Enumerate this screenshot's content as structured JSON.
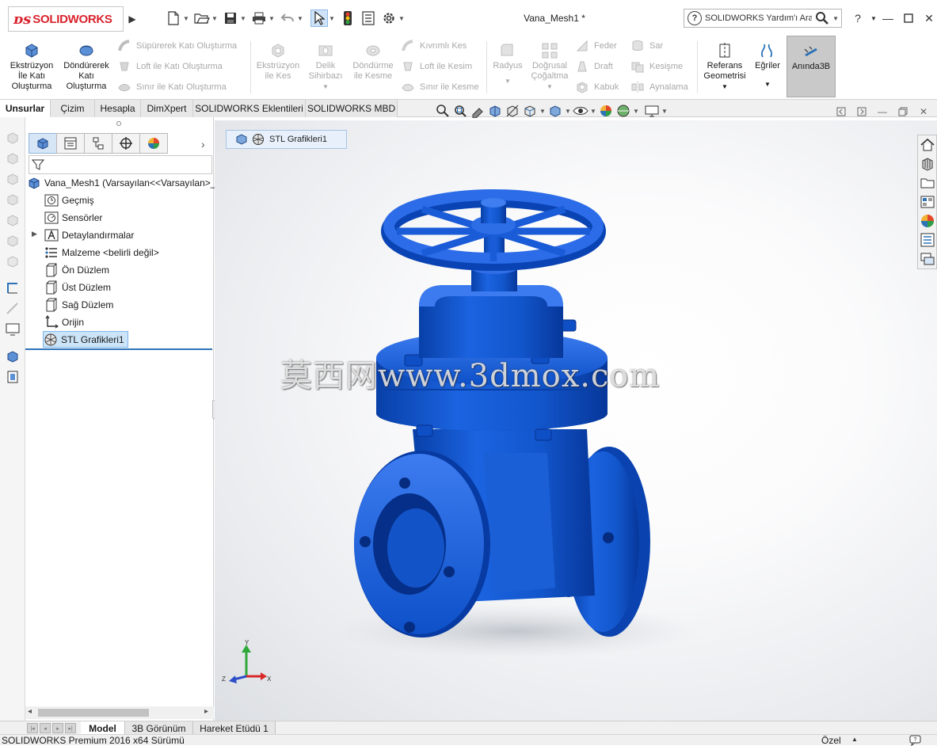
{
  "app": {
    "logo": "SOLIDWORKS",
    "document_title": "Vana_Mesh1 *",
    "help_search_placeholder": "SOLIDWORKS Yardım'ı Ara"
  },
  "ribbon": {
    "extrude_boss": "Ekstrüzyon İle Katı Oluşturma",
    "revolve_boss": "Döndürerek Katı Oluşturma",
    "swept_boss": "Süpürerek Katı Oluşturma",
    "loft_boss": "Loft ile Katı Oluşturma",
    "boundary_boss": "Sınır ile Katı Oluşturma",
    "extruded_cut": "Ekstrüzyon ile Kes",
    "hole_wizard": "Delik Sihirbazı",
    "revolved_cut": "Döndürme ile Kesme",
    "swept_cut": "Kıvrımlı Kes",
    "lofted_cut": "Loft ile Kesim",
    "boundary_cut": "Sınır ile Kesme",
    "fillet": "Radyus",
    "linear_pattern": "Doğrusal Çoğaltma",
    "rib": "Feder",
    "draft": "Draft",
    "shell": "Kabuk",
    "wrap": "Sar",
    "intersect": "Kesişme",
    "mirror": "Aynalama",
    "reference_geometry": "Referans Geometrisi",
    "curves": "Eğriler",
    "instant3d": "Anında3B"
  },
  "tabs": [
    "Unsurlar",
    "Çizim",
    "Hesapla",
    "DimXpert",
    "SOLIDWORKS Eklentileri",
    "SOLIDWORKS MBD"
  ],
  "feature_tree": {
    "root": "Vana_Mesh1  (Varsayılan<<Varsayılan>_",
    "items": [
      "Geçmiş",
      "Sensörler",
      "Detaylandırmalar",
      "Malzeme <belirli değil>",
      "Ön Düzlem",
      "Üst Düzlem",
      "Sağ Düzlem",
      "Orijin",
      "STL Grafikleri1"
    ]
  },
  "graphics": {
    "breadcrumb": "STL Grafikleri1",
    "watermark": "莫西网www.3dmox.com",
    "triad": {
      "x": "X",
      "y": "Y",
      "z": "Z"
    }
  },
  "bottom_tabs": [
    "Model",
    "3B Görünüm",
    "Hareket Etüdü 1"
  ],
  "status": {
    "version": "SOLIDWORKS Premium 2016 x64 Sürümü",
    "units": "Özel"
  },
  "colors": {
    "model_blue": "#0d50c8",
    "accent": "#2d73b8",
    "brand_red": "#d9232d"
  }
}
